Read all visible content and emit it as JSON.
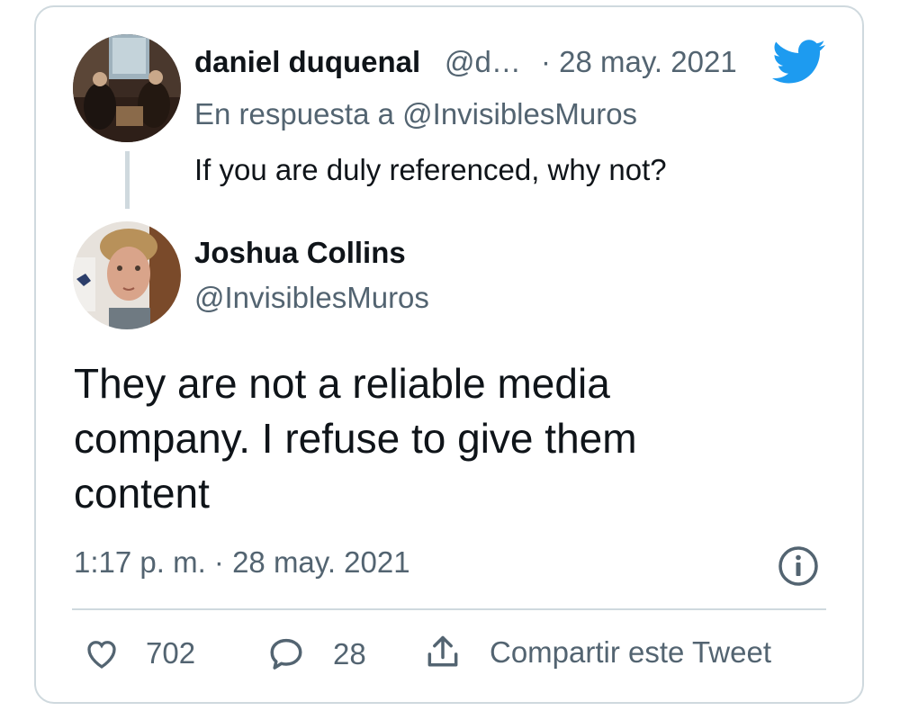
{
  "reply": {
    "author_name": "daniel duquenal",
    "author_handle": "@d…",
    "date": "· 28 may. 2021",
    "in_reply_to": "En respuesta a @InvisiblesMuros",
    "text": "If you are duly referenced, why not?"
  },
  "tweet": {
    "author_name": "Joshua Collins",
    "author_handle": "@InvisiblesMuros",
    "text": "They are not a reliable media company. I refuse to give them content",
    "timestamp": "1:17 p. m. · 28 may. 2021"
  },
  "actions": {
    "likes": "702",
    "replies": "28",
    "share_label": "Compartir este Tweet"
  },
  "colors": {
    "twitter_blue": "#1d9bf0",
    "muted": "#536471",
    "border": "#cfd9de"
  },
  "icons": [
    "twitter-bird-icon",
    "info-icon",
    "heart-icon",
    "reply-icon",
    "share-icon"
  ]
}
